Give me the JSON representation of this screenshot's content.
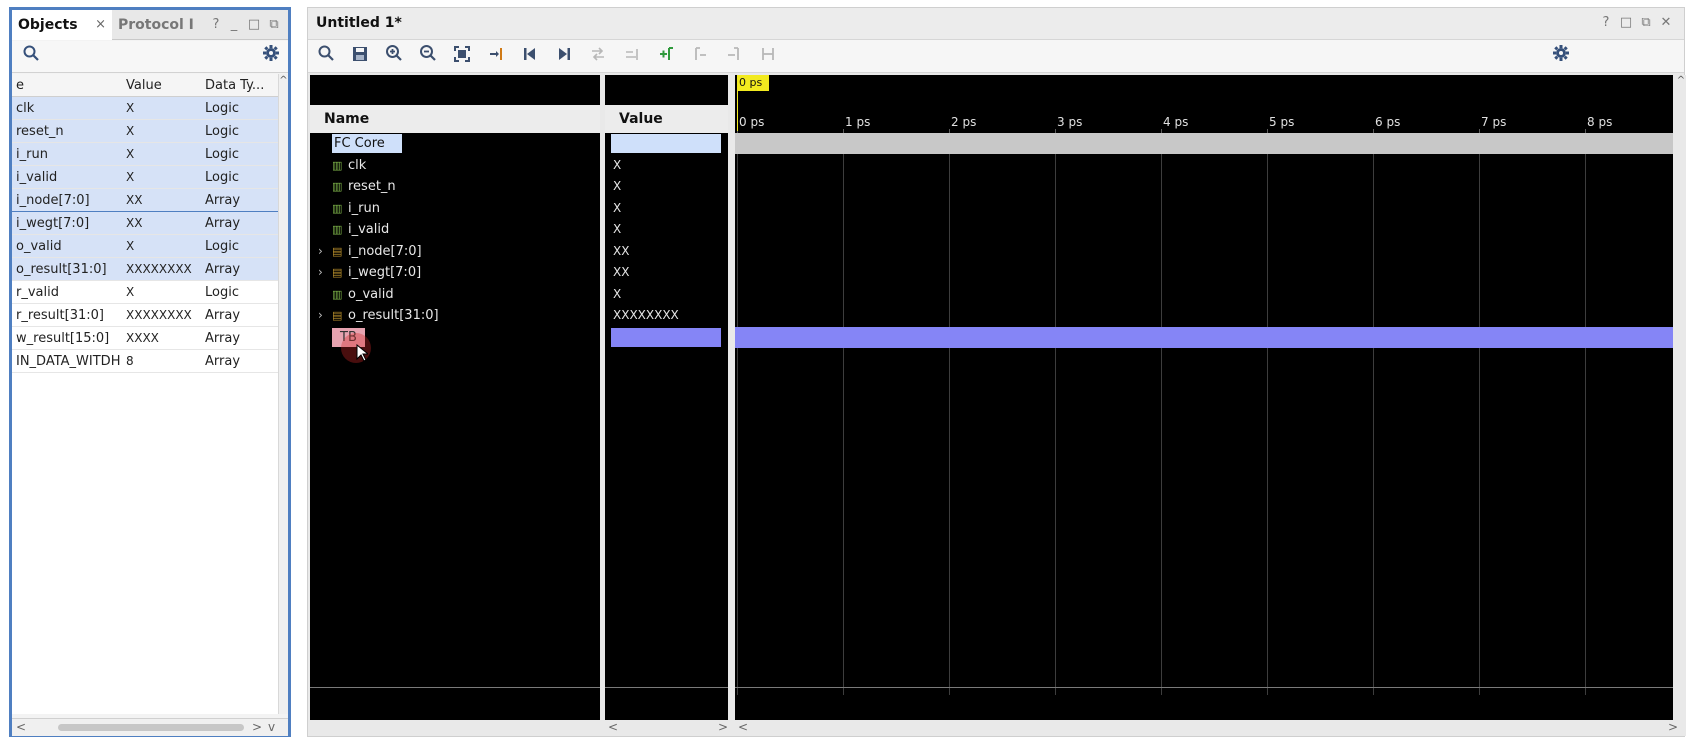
{
  "objects_panel": {
    "tabs": [
      {
        "label": "Objects",
        "close": "×"
      },
      {
        "label": "Protocol I"
      }
    ],
    "window_buttons": [
      "?",
      "_",
      "□",
      "⧉"
    ],
    "columns": [
      "e",
      "Value",
      "Data Ty..."
    ],
    "rows": [
      {
        "name": "clk",
        "value": "X",
        "type": "Logic"
      },
      {
        "name": "reset_n",
        "value": "X",
        "type": "Logic"
      },
      {
        "name": "i_run",
        "value": "X",
        "type": "Logic"
      },
      {
        "name": "i_valid",
        "value": "X",
        "type": "Logic"
      },
      {
        "name": "i_node[7:0]",
        "value": "XX",
        "type": "Array"
      },
      {
        "name": "i_wegt[7:0]",
        "value": "XX",
        "type": "Array"
      },
      {
        "name": "o_valid",
        "value": "X",
        "type": "Logic"
      },
      {
        "name": "o_result[31:0]",
        "value": "XXXXXXXX",
        "type": "Array"
      },
      {
        "name": "r_valid",
        "value": "X",
        "type": "Logic"
      },
      {
        "name": "r_result[31:0]",
        "value": "XXXXXXXX",
        "type": "Array"
      },
      {
        "name": "w_result[15:0]",
        "value": "XXXX",
        "type": "Array"
      },
      {
        "name": "IN_DATA_WITDH",
        "value": "8",
        "type": "Array"
      }
    ]
  },
  "wave_window": {
    "title": "Untitled 1*",
    "window_buttons": [
      "?",
      "□",
      "⧉",
      "✕"
    ],
    "name_header": "Name",
    "value_header": "Value",
    "cursor_label": "0 ps",
    "ticks": [
      "0 ps",
      "1 ps",
      "2 ps",
      "3 ps",
      "4 ps",
      "5 ps",
      "6 ps",
      "7 ps",
      "8 ps"
    ],
    "signals": [
      {
        "name": "FC Core",
        "value": "",
        "kind": "group"
      },
      {
        "name": "clk",
        "value": "X",
        "kind": "logic"
      },
      {
        "name": "reset_n",
        "value": "X",
        "kind": "logic"
      },
      {
        "name": "i_run",
        "value": "X",
        "kind": "logic"
      },
      {
        "name": "i_valid",
        "value": "X",
        "kind": "logic"
      },
      {
        "name": "i_node[7:0]",
        "value": "XX",
        "kind": "bus"
      },
      {
        "name": "i_wegt[7:0]",
        "value": "XX",
        "kind": "bus"
      },
      {
        "name": "o_valid",
        "value": "X",
        "kind": "logic"
      },
      {
        "name": "o_result[31:0]",
        "value": "XXXXXXXX",
        "kind": "bus"
      },
      {
        "name": "TB",
        "value": "",
        "kind": "group"
      }
    ]
  },
  "colors": {
    "selection_blue": "#d6e2f7",
    "tb_divider": "#8585f6",
    "fc_core_divider": "#c8c8c8",
    "cursor_yellow": "#f2ea1f",
    "panel_border": "#4f7fc1"
  }
}
